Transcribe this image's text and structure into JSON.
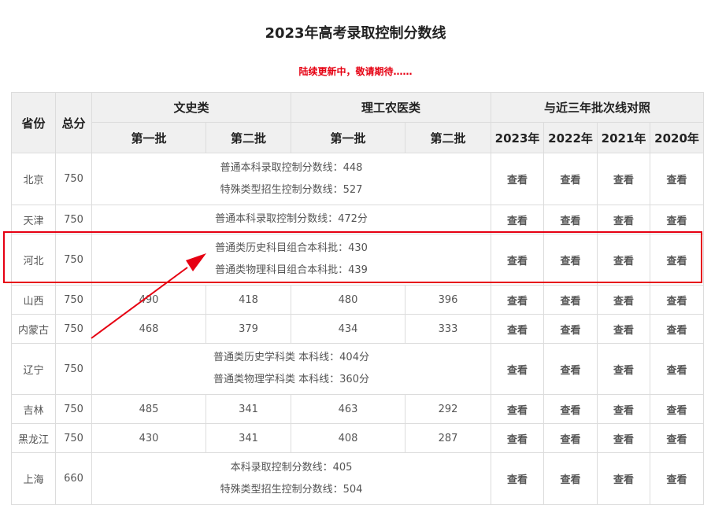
{
  "page": {
    "title": "2023年高考录取控制分数线",
    "notice": "陆续更新中，敬请期待……"
  },
  "table": {
    "head": {
      "province": "省份",
      "total": "总分",
      "wenshi": "文史类",
      "ligong": "理工农医类",
      "compare": "与近三年批次线对照",
      "batch1": "第一批",
      "batch2": "第二批",
      "years": [
        "2023年",
        "2022年",
        "2021年",
        "2020年"
      ]
    },
    "link_text": "查看",
    "rows": [
      {
        "province": "北京",
        "total": "750",
        "merged": [
          "普通本科录取控制分数线：448",
          "特殊类型招生控制分数线：527"
        ]
      },
      {
        "province": "天津",
        "total": "750",
        "merged": [
          "普通本科录取控制分数线：472分"
        ]
      },
      {
        "province": "河北",
        "total": "750",
        "merged": [
          "普通类历史科目组合本科批：430",
          "普通类物理科目组合本科批：439"
        ]
      },
      {
        "province": "山西",
        "total": "750",
        "cells": [
          "490",
          "418",
          "480",
          "396"
        ]
      },
      {
        "province": "内蒙古",
        "total": "750",
        "cells": [
          "468",
          "379",
          "434",
          "333"
        ]
      },
      {
        "province": "辽宁",
        "total": "750",
        "merged": [
          "普通类历史学科类 本科线：404分",
          "普通类物理学科类 本科线：360分"
        ]
      },
      {
        "province": "吉林",
        "total": "750",
        "cells": [
          "485",
          "341",
          "463",
          "292"
        ]
      },
      {
        "province": "黑龙江",
        "total": "750",
        "cells": [
          "430",
          "341",
          "408",
          "287"
        ]
      },
      {
        "province": "上海",
        "total": "660",
        "merged": [
          "本科录取控制分数线：405",
          "特殊类型招生控制分数线：504"
        ]
      }
    ]
  },
  "annotation": {
    "highlight_color": "#e60012"
  }
}
